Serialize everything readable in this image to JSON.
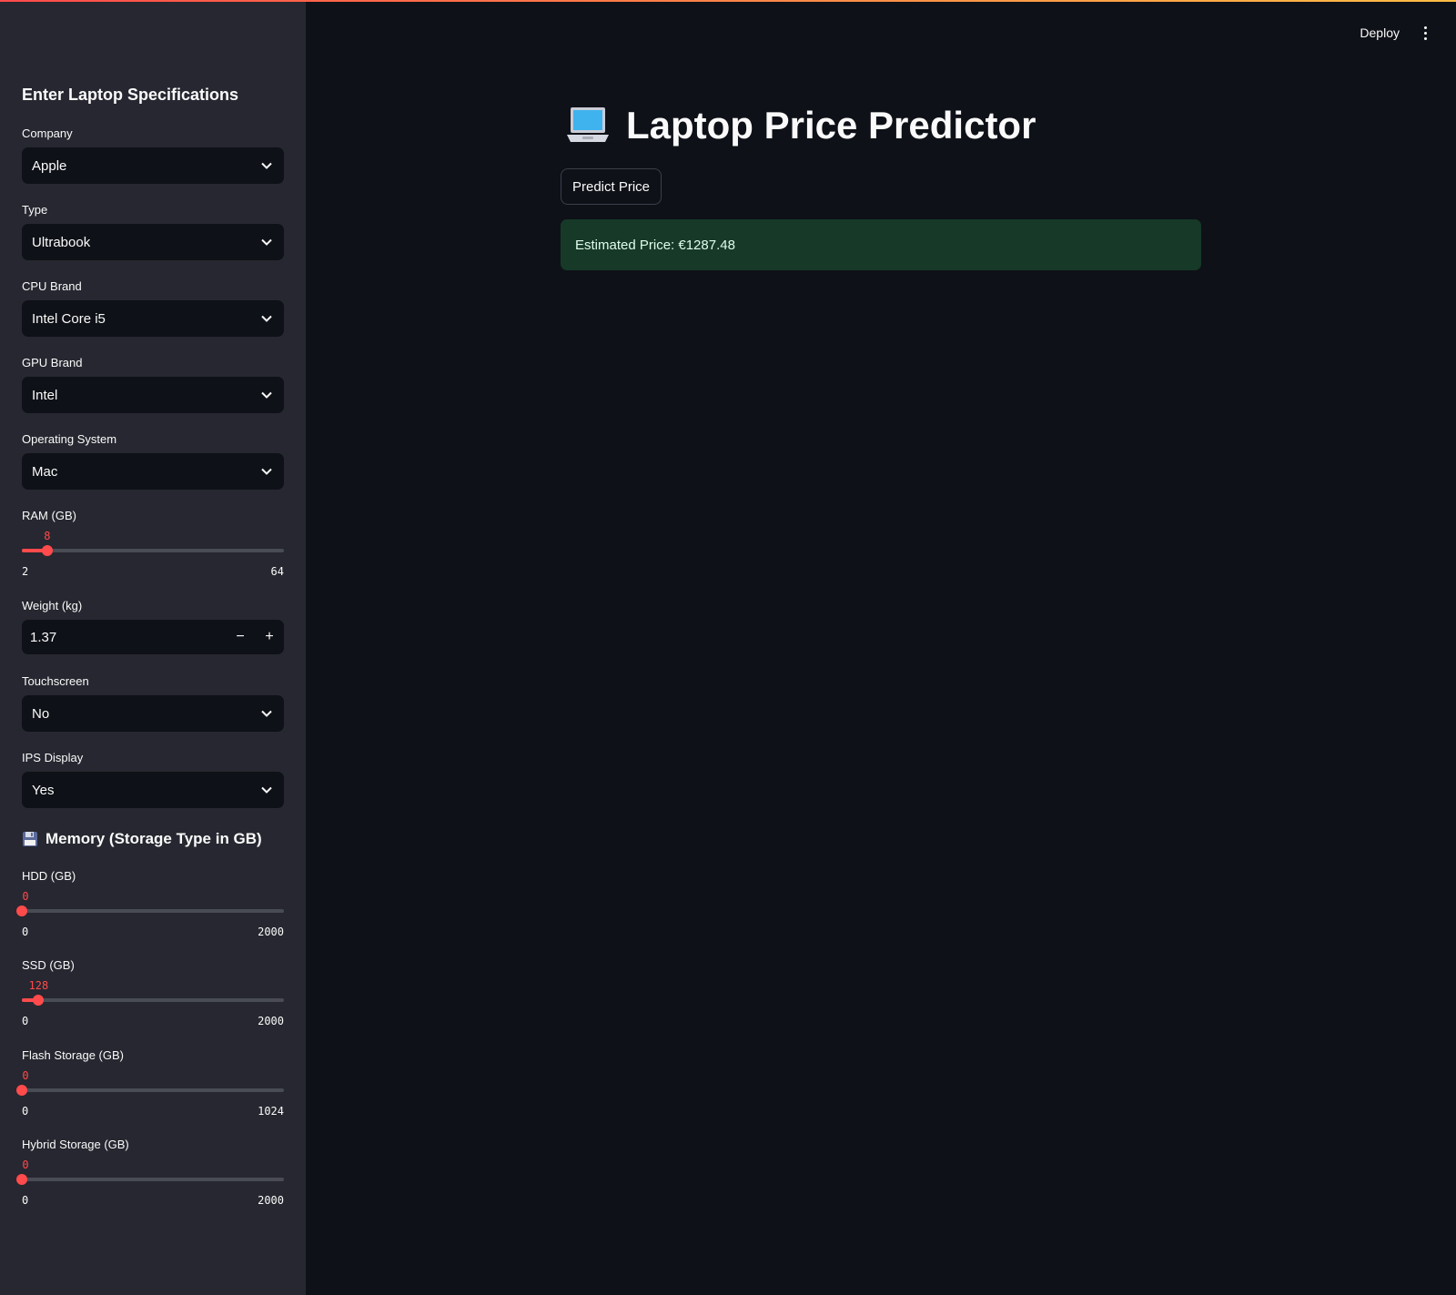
{
  "sidebar": {
    "title": "Enter Laptop Specifications",
    "company": {
      "label": "Company",
      "value": "Apple"
    },
    "type": {
      "label": "Type",
      "value": "Ultrabook"
    },
    "cpu": {
      "label": "CPU Brand",
      "value": "Intel Core i5"
    },
    "gpu": {
      "label": "GPU Brand",
      "value": "Intel"
    },
    "os": {
      "label": "Operating System",
      "value": "Mac"
    },
    "ram": {
      "label": "RAM (GB)",
      "value": "8",
      "min": "2",
      "max": "64",
      "fraction": 0.097
    },
    "weight": {
      "label": "Weight (kg)",
      "value": "1.37",
      "minus": "−",
      "plus": "+"
    },
    "touchscreen": {
      "label": "Touchscreen",
      "value": "No"
    },
    "ips": {
      "label": "IPS Display",
      "value": "Yes"
    },
    "memory_title": "Memory (Storage Type in GB)",
    "hdd": {
      "label": "HDD (GB)",
      "value": "0",
      "min": "0",
      "max": "2000",
      "fraction": 0
    },
    "ssd": {
      "label": "SSD (GB)",
      "value": "128",
      "min": "0",
      "max": "2000",
      "fraction": 0.064
    },
    "flash": {
      "label": "Flash Storage (GB)",
      "value": "0",
      "min": "0",
      "max": "1024",
      "fraction": 0
    },
    "hybrid": {
      "label": "Hybrid Storage (GB)",
      "value": "0",
      "min": "0",
      "max": "2000",
      "fraction": 0
    }
  },
  "header": {
    "deploy_label": "Deploy"
  },
  "main": {
    "title": "Laptop Price Predictor",
    "predict_label": "Predict Price",
    "result": "Estimated Price: €1287.48"
  },
  "colors": {
    "accent": "#ff4b4b",
    "success_bg": "#173928",
    "sidebar_bg": "#262730",
    "main_bg": "#0e1117"
  }
}
